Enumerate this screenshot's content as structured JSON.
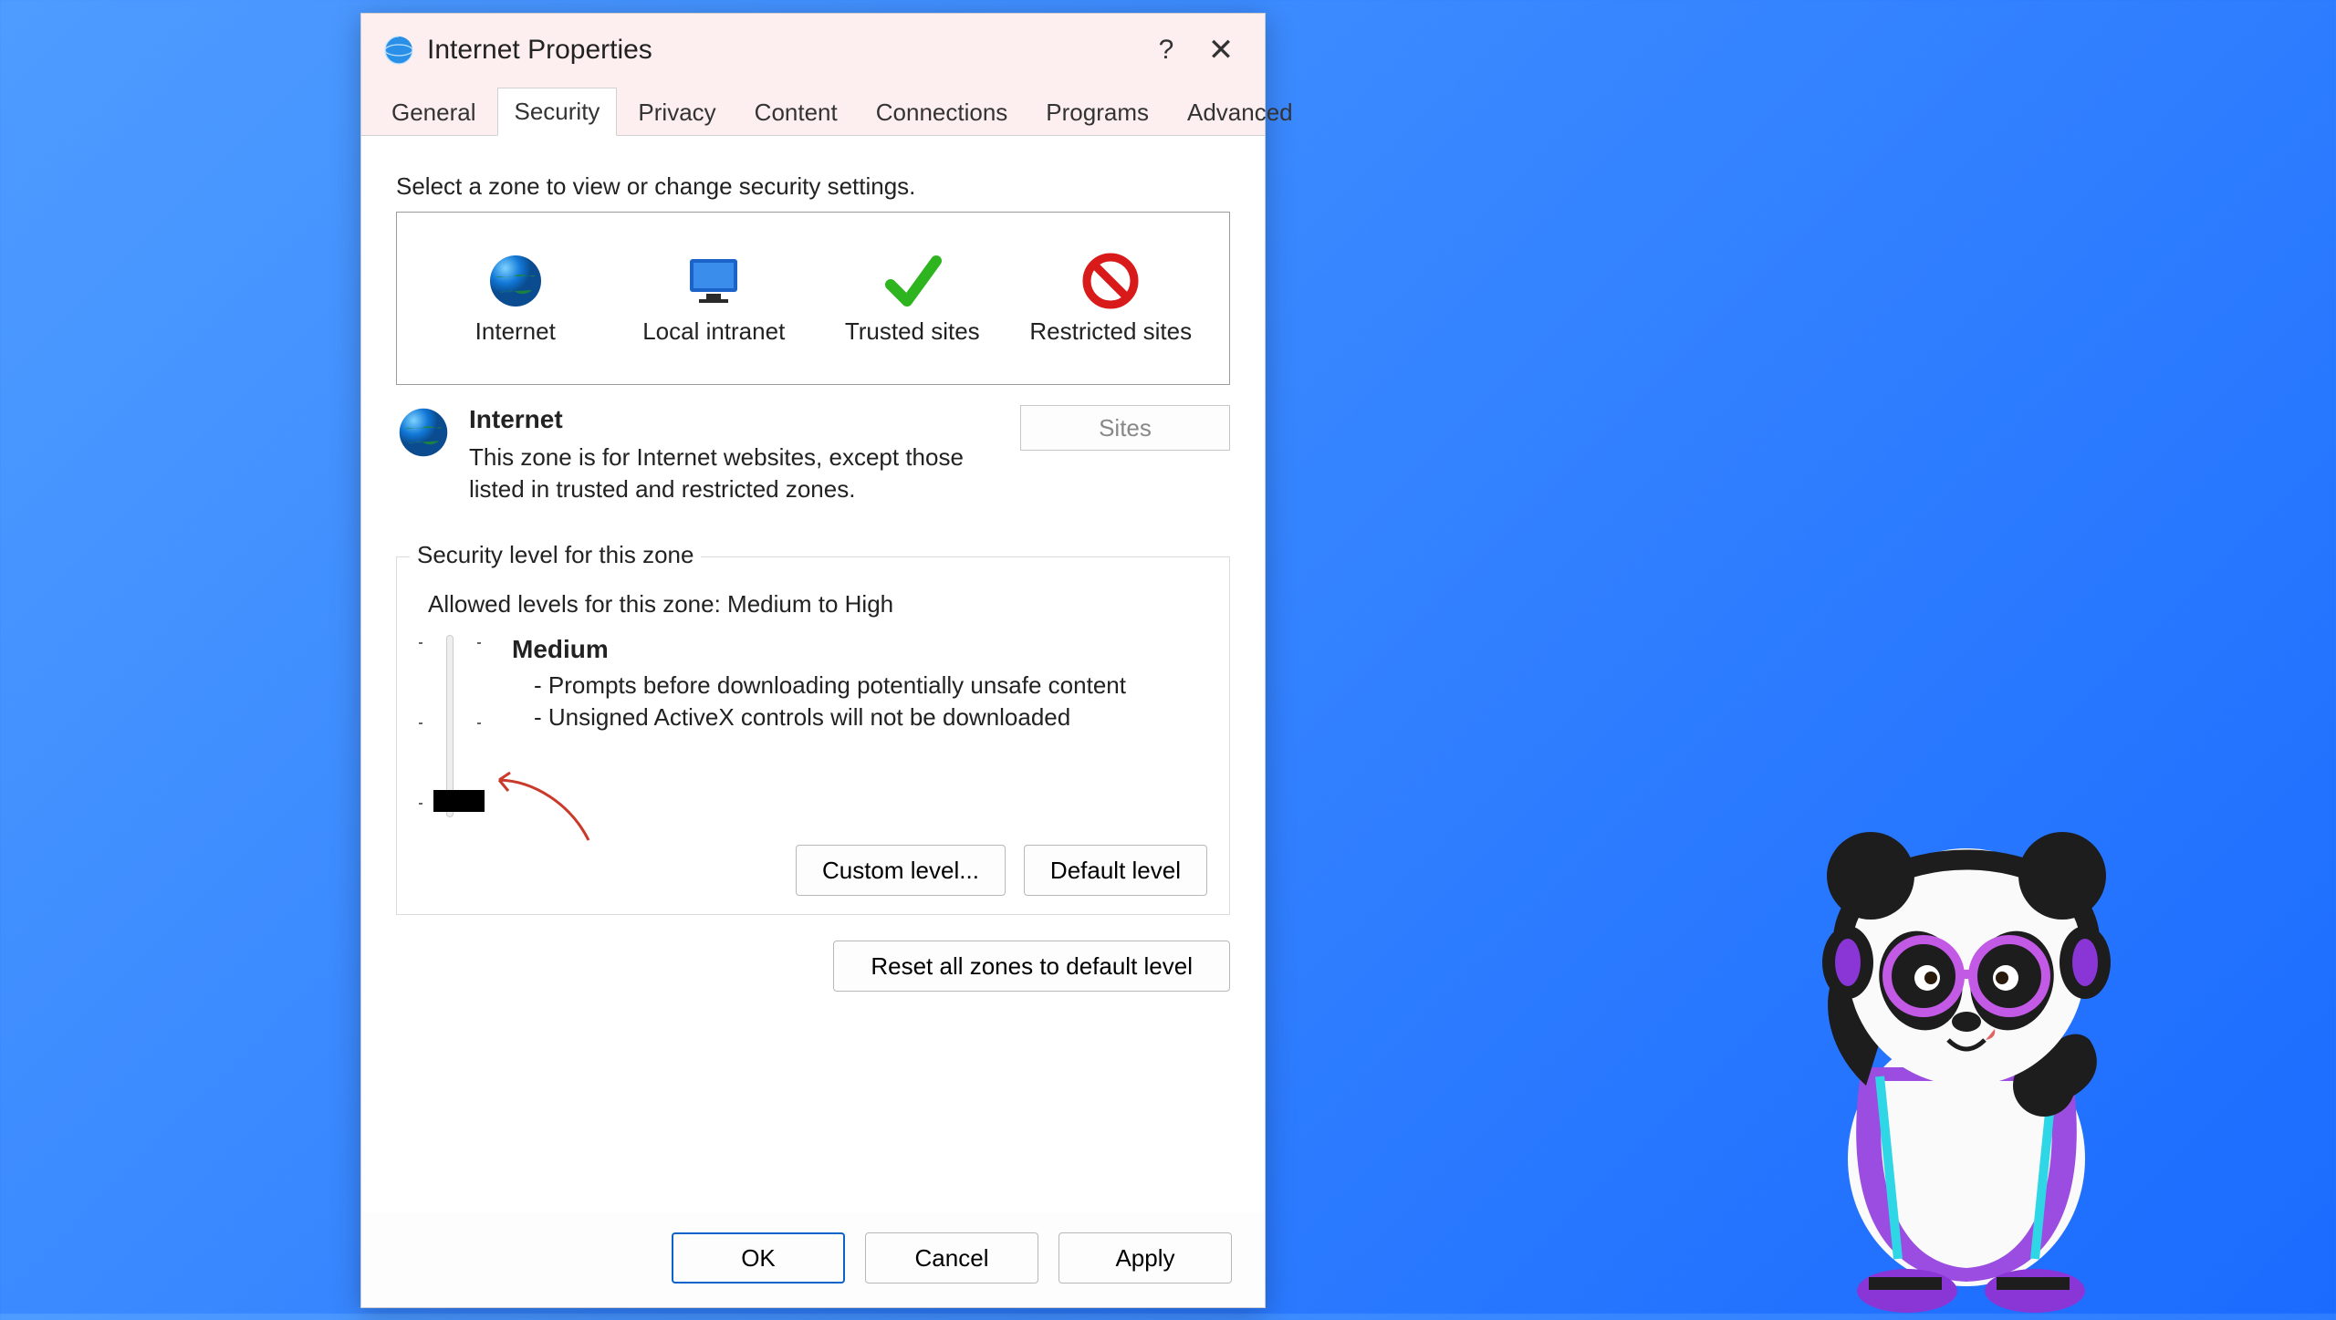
{
  "window": {
    "title": "Internet Properties",
    "help_glyph": "?",
    "close_glyph": "✕"
  },
  "tabs": [
    "General",
    "Security",
    "Privacy",
    "Content",
    "Connections",
    "Programs",
    "Advanced"
  ],
  "active_tab": "Security",
  "zone_instruction": "Select a zone to view or change security settings.",
  "zones": [
    {
      "id": "internet",
      "label": "Internet",
      "selected": true
    },
    {
      "id": "local-intranet",
      "label": "Local intranet",
      "selected": false
    },
    {
      "id": "trusted-sites",
      "label": "Trusted sites",
      "selected": false
    },
    {
      "id": "restricted-sites",
      "label": "Restricted sites",
      "selected": false
    }
  ],
  "current_zone": {
    "name": "Internet",
    "description": "This zone is for Internet websites, except those listed in trusted and restricted zones."
  },
  "sites_button": "Sites",
  "group_title": "Security level for this zone",
  "allowed_levels": "Allowed levels for this zone: Medium to High",
  "level": {
    "name": "Medium",
    "bullets": [
      "- Prompts before downloading potentially unsafe content",
      "- Unsigned ActiveX controls will not be downloaded"
    ]
  },
  "buttons": {
    "custom_level": "Custom level...",
    "default_level": "Default level",
    "reset_all": "Reset all zones to default level",
    "ok": "OK",
    "cancel": "Cancel",
    "apply": "Apply"
  }
}
